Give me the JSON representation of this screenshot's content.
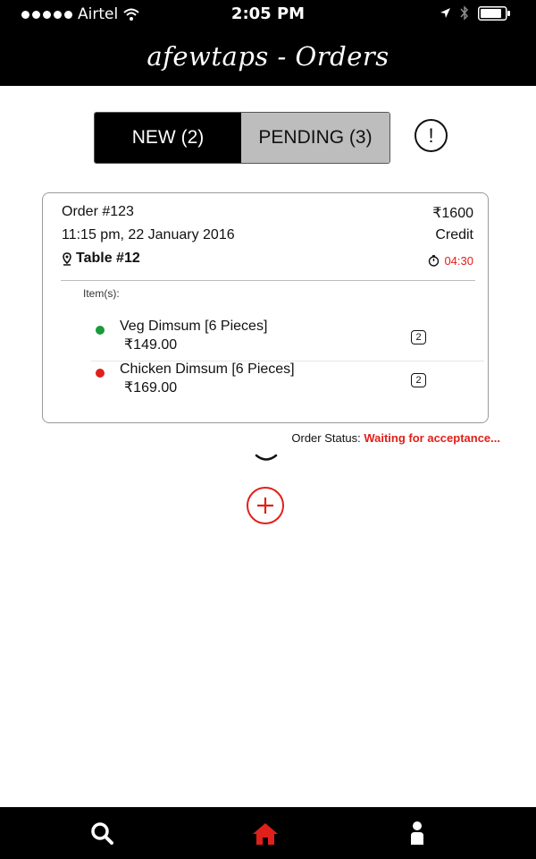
{
  "status_bar": {
    "carrier": "Airtel",
    "time": "2:05 PM"
  },
  "header": {
    "title": "afewtaps - Orders"
  },
  "tabs": {
    "new_label": "NEW (2)",
    "pending_label": "PENDING (3)",
    "active": "new"
  },
  "order": {
    "number": "Order #123",
    "amount": "₹1600",
    "datetime": "11:15 pm, 22 January 2016",
    "payment": "Credit",
    "table": "Table #12",
    "timer": "04:30",
    "items_label": "Item(s):",
    "items": [
      {
        "name": "Veg Dimsum [6 Pieces]",
        "price": "₹149.00",
        "qty": "2",
        "type_color": "#1a9a3a"
      },
      {
        "name": "Chicken Dimsum [6 Pieces]",
        "price": "₹169.00",
        "qty": "2",
        "type_color": "#e0201a"
      }
    ],
    "status_label": "Order Status:",
    "status_value": "Waiting for acceptance..."
  },
  "icons": {
    "info": "!",
    "nav": [
      "search-icon",
      "home-icon",
      "profile-icon"
    ]
  },
  "colors": {
    "accent_red": "#e0201a",
    "veg_green": "#1a9a3a",
    "bar_black": "#000000",
    "pending_tab_gray": "#bdbdbd"
  }
}
